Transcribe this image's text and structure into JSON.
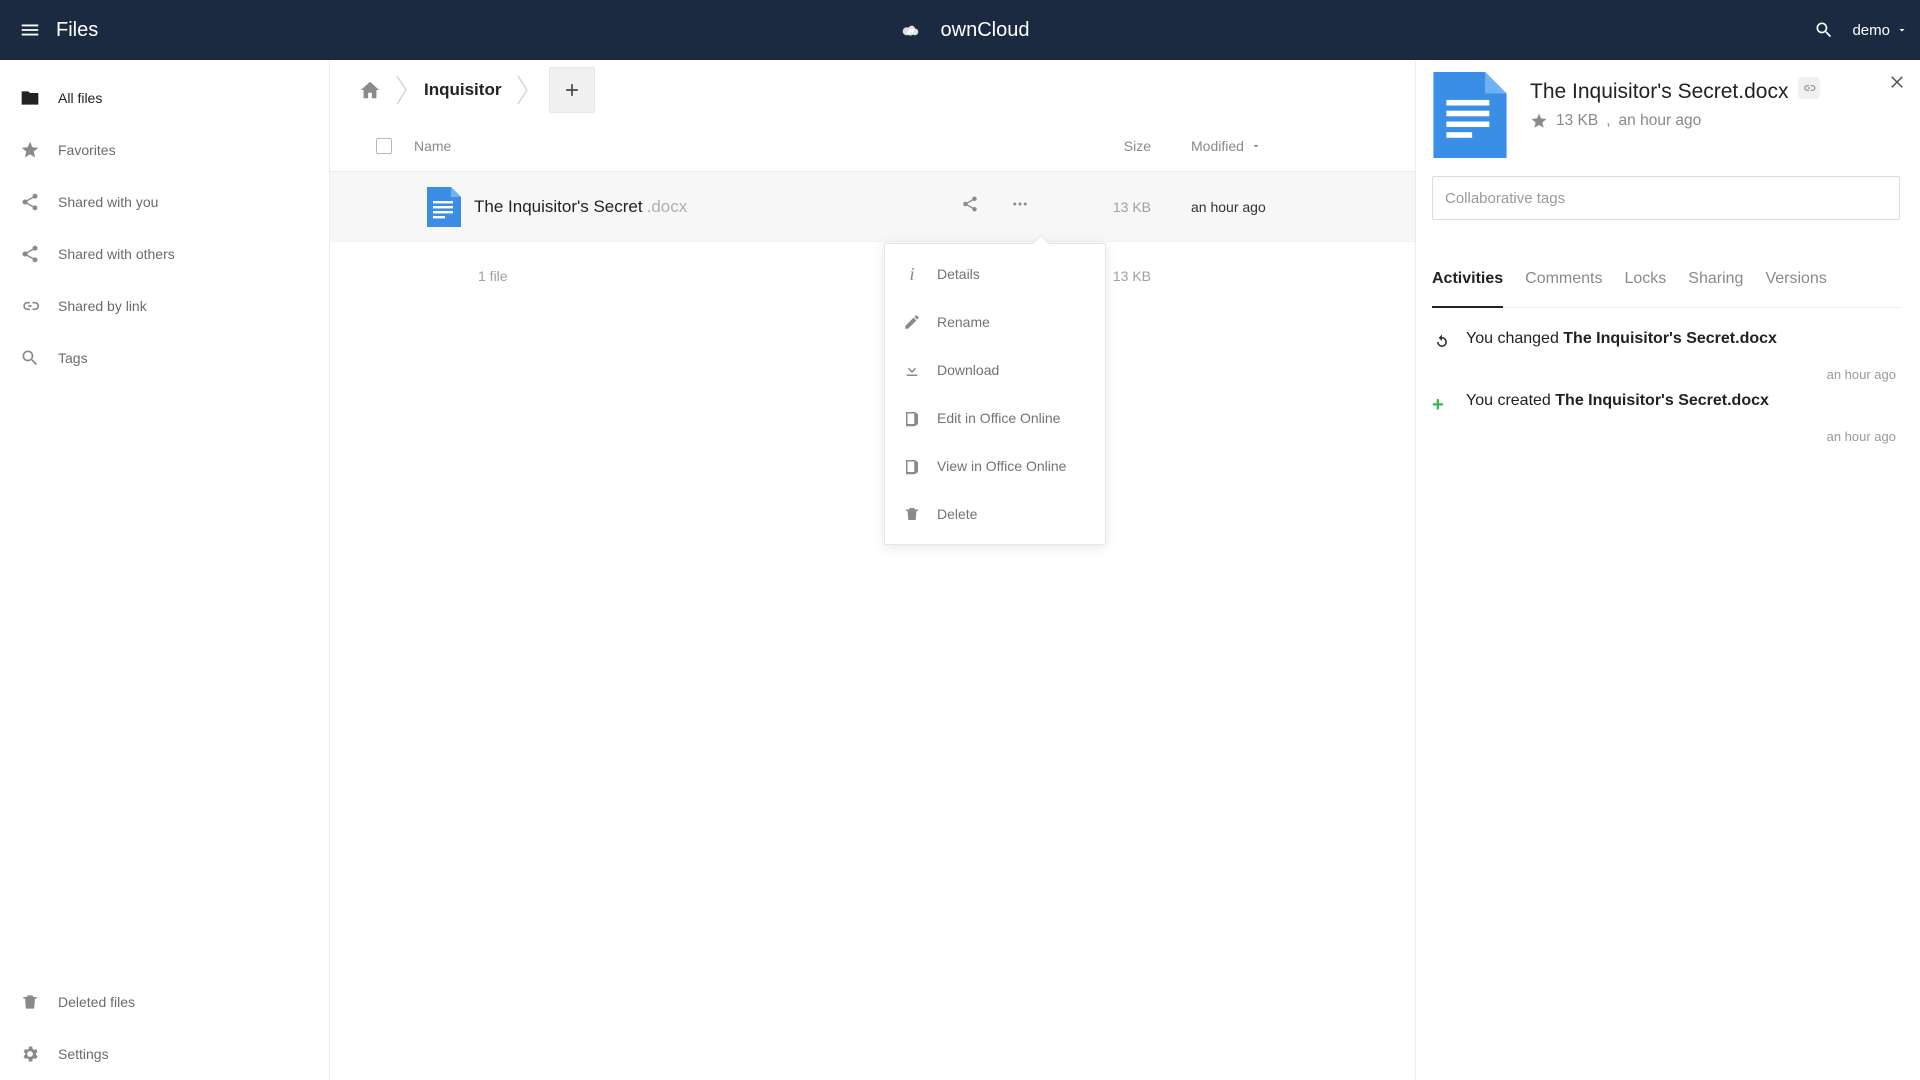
{
  "header": {
    "app_label": "Files",
    "brand_name": "ownCloud",
    "user_label": "demo"
  },
  "sidebar": {
    "items": [
      {
        "label": "All files"
      },
      {
        "label": "Favorites"
      },
      {
        "label": "Shared with you"
      },
      {
        "label": "Shared with others"
      },
      {
        "label": "Shared by link"
      },
      {
        "label": "Tags"
      }
    ],
    "bottom": [
      {
        "label": "Deleted files"
      },
      {
        "label": "Settings"
      }
    ]
  },
  "breadcrumb": {
    "folder": "Inquisitor"
  },
  "table": {
    "headers": {
      "name": "Name",
      "size": "Size",
      "modified": "Modified"
    },
    "row": {
      "name": "The Inquisitor's Secret",
      "ext": ".docx",
      "size": "13 KB",
      "modified": "an hour ago"
    },
    "summary": {
      "count_label": "1 file",
      "total_size": "13 KB"
    }
  },
  "context_menu": [
    {
      "label": "Details"
    },
    {
      "label": "Rename"
    },
    {
      "label": "Download"
    },
    {
      "label": "Edit in Office Online"
    },
    {
      "label": "View in Office Online"
    },
    {
      "label": "Delete"
    }
  ],
  "details": {
    "title": "The Inquisitor's Secret.docx",
    "meta_size": "13 KB",
    "meta_time": "an hour ago",
    "tags_placeholder": "Collaborative tags",
    "tabs": [
      "Activities",
      "Comments",
      "Locks",
      "Sharing",
      "Versions"
    ],
    "activities": [
      {
        "prefix": "You changed ",
        "strong": "The Inquisitor's Secret.docx",
        "time": "an hour ago",
        "type": "changed"
      },
      {
        "prefix": "You created ",
        "strong": "The Inquisitor's Secret.docx",
        "time": "an hour ago",
        "type": "created"
      }
    ]
  }
}
